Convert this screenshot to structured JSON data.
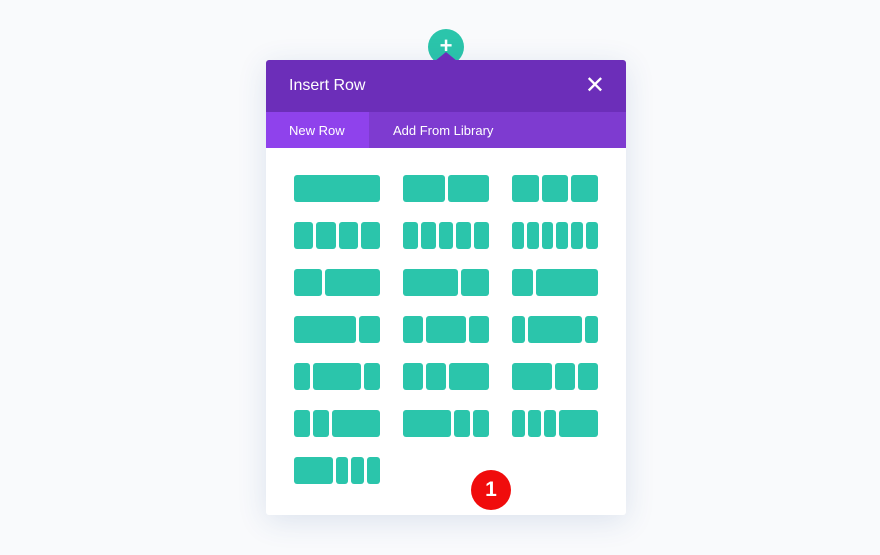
{
  "add_button": {
    "icon": "plus-icon",
    "label": "+"
  },
  "panel": {
    "title": "Insert Row",
    "close_icon": "close-icon",
    "close_label": "✕"
  },
  "tabs": [
    {
      "label": "New Row",
      "active": true
    },
    {
      "label": "Add From Library",
      "active": false
    }
  ],
  "layouts": [
    [
      1
    ],
    [
      1,
      1
    ],
    [
      1,
      1,
      1
    ],
    [
      1,
      1,
      1,
      1
    ],
    [
      1,
      1,
      1,
      1,
      1
    ],
    [
      1,
      1,
      1,
      1,
      1,
      1
    ],
    [
      1,
      2
    ],
    [
      2,
      1
    ],
    [
      1,
      3
    ],
    [
      3,
      1
    ],
    [
      1,
      2,
      1
    ],
    [
      1,
      4,
      1
    ],
    [
      1,
      3,
      1
    ],
    [
      1,
      1,
      2
    ],
    [
      2,
      1,
      1
    ],
    [
      1,
      1,
      3
    ],
    [
      3,
      1,
      1
    ],
    [
      1,
      1,
      1,
      3
    ],
    [
      3,
      1,
      1,
      1
    ]
  ],
  "badge": {
    "label": "1"
  },
  "colors": {
    "header": "#6c2eb9",
    "tab_bar": "#7e3bd0",
    "tab_active": "#8f42ec",
    "column": "#2bc5ab",
    "badge": "#f00c0c"
  }
}
